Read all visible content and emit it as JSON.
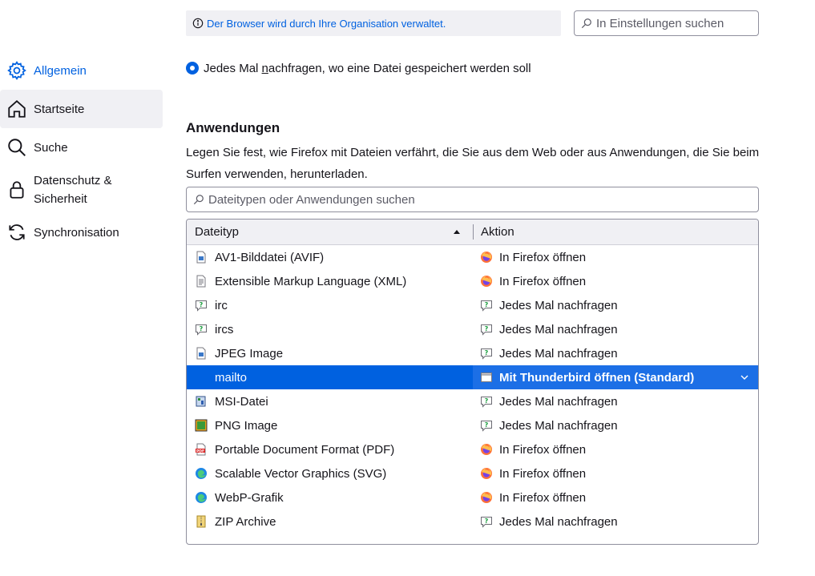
{
  "sidebar": {
    "items": [
      {
        "label": "Allgemein",
        "icon": "gear-icon",
        "active": true
      },
      {
        "label": "Startseite",
        "icon": "home-icon"
      },
      {
        "label": "Suche",
        "icon": "search-icon"
      },
      {
        "label": "Datenschutz &",
        "label2": "Sicherheit",
        "icon": "lock-icon"
      },
      {
        "label": "Synchronisation",
        "icon": "sync-icon"
      }
    ]
  },
  "banner": {
    "text": "Der Browser wird durch Ihre Organisation verwaltet."
  },
  "search_settings": {
    "placeholder": "In Einstellungen suchen"
  },
  "download": {
    "ask_label_pre": "Jedes Mal ",
    "ask_label_u": "n",
    "ask_label_post": "achfragen, wo eine Datei gespeichert werden soll"
  },
  "applications": {
    "heading": "Anwendungen",
    "description": "Legen Sie fest, wie Firefox mit Dateien verfährt, die Sie aus dem Web oder aus Anwendungen, die Sie beim Surfen verwenden, herunterladen.",
    "search_placeholder": "Dateitypen oder Anwendungen suchen",
    "columns": {
      "type": "Dateityp",
      "action": "Aktion"
    },
    "rows": [
      {
        "type": "AV1-Bilddatei (AVIF)",
        "action": "In Firefox öffnen",
        "file_icon": "image-file-icon",
        "action_icon": "firefox-icon"
      },
      {
        "type": "Extensible Markup Language (XML)",
        "action": "In Firefox öffnen",
        "file_icon": "text-file-icon",
        "action_icon": "firefox-icon"
      },
      {
        "type": "irc",
        "action": "Jedes Mal nachfragen",
        "file_icon": "ask-icon",
        "action_icon": "ask-icon"
      },
      {
        "type": "ircs",
        "action": "Jedes Mal nachfragen",
        "file_icon": "ask-icon",
        "action_icon": "ask-icon"
      },
      {
        "type": "JPEG Image",
        "action": "Jedes Mal nachfragen",
        "file_icon": "image-file-icon",
        "action_icon": "ask-icon"
      },
      {
        "type": "mailto",
        "action": "Mit Thunderbird öffnen (Standard)",
        "file_icon": "none",
        "action_icon": "app-window-icon",
        "selected": true
      },
      {
        "type": "MSI-Datei",
        "action": "Jedes Mal nachfragen",
        "file_icon": "installer-icon",
        "action_icon": "ask-icon"
      },
      {
        "type": "PNG Image",
        "action": "Jedes Mal nachfragen",
        "file_icon": "png-file-icon",
        "action_icon": "ask-icon"
      },
      {
        "type": "Portable Document Format (PDF)",
        "action": "In Firefox öffnen",
        "file_icon": "pdf-file-icon",
        "action_icon": "firefox-icon"
      },
      {
        "type": "Scalable Vector Graphics (SVG)",
        "action": "In Firefox öffnen",
        "file_icon": "edge-icon",
        "action_icon": "firefox-icon"
      },
      {
        "type": "WebP-Grafik",
        "action": "In Firefox öffnen",
        "file_icon": "edge-icon",
        "action_icon": "firefox-icon"
      },
      {
        "type": "ZIP Archive",
        "action": "Jedes Mal nachfragen",
        "file_icon": "zip-file-icon",
        "action_icon": "ask-icon"
      }
    ]
  },
  "colors": {
    "accent": "#0061e0",
    "selected_row": "#0061e0",
    "hover_bg": "#f0f0f4"
  }
}
